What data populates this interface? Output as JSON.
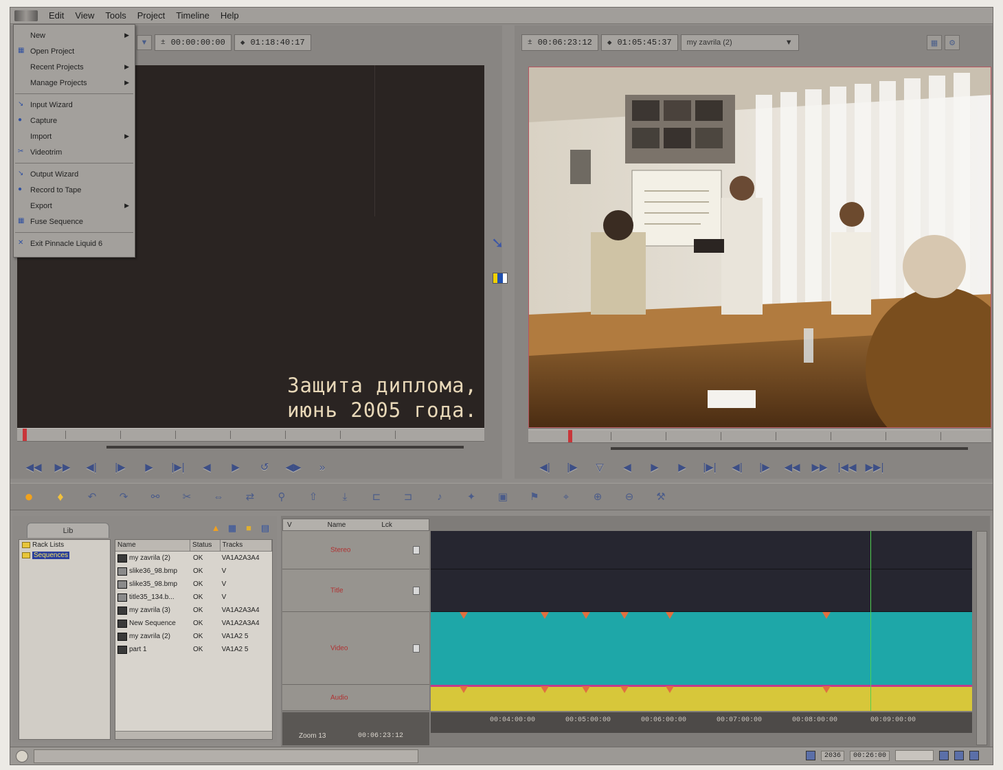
{
  "menubar": {
    "items": [
      "Edit",
      "View",
      "Tools",
      "Project",
      "Timeline",
      "Help"
    ]
  },
  "file_menu": {
    "items": [
      {
        "label": "New",
        "submenu": true,
        "icon": ""
      },
      {
        "label": "Open Project",
        "submenu": false,
        "icon": "open-project-icon"
      },
      {
        "label": "Recent Projects",
        "submenu": true,
        "icon": ""
      },
      {
        "label": "Manage Projects",
        "submenu": true,
        "icon": ""
      },
      {
        "sep": true
      },
      {
        "label": "Input Wizard",
        "submenu": false,
        "icon": "input-wizard-icon"
      },
      {
        "label": "Capture",
        "submenu": false,
        "icon": "capture-icon"
      },
      {
        "label": "Import",
        "submenu": true,
        "icon": ""
      },
      {
        "label": "Videotrim",
        "submenu": false,
        "icon": "videotrim-icon"
      },
      {
        "sep": true
      },
      {
        "label": "Output Wizard",
        "submenu": false,
        "icon": "output-wizard-icon"
      },
      {
        "label": "Record to Tape",
        "submenu": false,
        "icon": "record-to-tape-icon"
      },
      {
        "label": "Export",
        "submenu": true,
        "icon": ""
      },
      {
        "label": "Fuse Sequence",
        "submenu": false,
        "icon": "fuse-sequence-icon"
      },
      {
        "sep": true
      },
      {
        "label": "Exit Pinnacle Liquid 6",
        "submenu": false,
        "icon": "exit-icon"
      }
    ]
  },
  "source_monitor": {
    "tc_in": "00:00:00:00",
    "tc_duration": "01:18:40:17",
    "subtitle_line1": "Защита диплома,",
    "subtitle_line2": "июнь 2005 года."
  },
  "record_monitor": {
    "tc_in": "00:06:23:12",
    "tc_duration": "01:05:45:37",
    "sequence_name": "my zavrila (2)"
  },
  "project": {
    "tab_label": "Lib",
    "bins": [
      {
        "label": "Rack Lists",
        "selected": false
      },
      {
        "label": "Sequences",
        "selected": true
      }
    ],
    "columns": [
      "Name",
      "Status",
      "Tracks"
    ],
    "files": [
      {
        "name": "my zavrila (2)",
        "status": "OK",
        "tracks": "VA1A2A3A4",
        "type": "seq"
      },
      {
        "name": "slike36_98.bmp",
        "status": "OK",
        "tracks": "V",
        "type": "img"
      },
      {
        "name": "slike35_98.bmp",
        "status": "OK",
        "tracks": "V",
        "type": "img"
      },
      {
        "name": "title35_134.b...",
        "status": "OK",
        "tracks": "V",
        "type": "img"
      },
      {
        "name": "my zavrila (3)",
        "status": "OK",
        "tracks": "VA1A2A3A4",
        "type": "seq"
      },
      {
        "name": "New Sequence",
        "status": "OK",
        "tracks": "VA1A2A3A4",
        "type": "seq"
      },
      {
        "name": "my zavrila (2)",
        "status": "OK",
        "tracks": "VA1A2 5",
        "type": "seq"
      },
      {
        "name": "part 1",
        "status": "OK",
        "tracks": "VA1A2 5",
        "type": "seq"
      }
    ]
  },
  "timeline": {
    "header_labels": [
      "V",
      "Name",
      "Lck"
    ],
    "tracks": [
      {
        "name": "Stereo"
      },
      {
        "name": "Title"
      },
      {
        "name": "Video"
      },
      {
        "name": "Audio"
      }
    ],
    "ruler_labels": [
      "00:04:00:00",
      "00:05:00:00",
      "00:06:00:00",
      "00:07:00:00",
      "00:08:00:00",
      "00:09:00:00"
    ],
    "zoom_label": "Zoom 13",
    "zoom_tc": "00:06:23:12"
  },
  "status_bar": {
    "values": [
      "2036",
      "00:26:00"
    ]
  }
}
